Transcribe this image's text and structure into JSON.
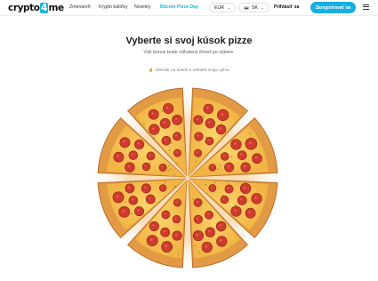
{
  "header": {
    "logo_prefix": "crypto",
    "logo_four": "4",
    "logo_suffix": "me",
    "nav": [
      "Zmenáreň",
      "Krypto balíčky",
      "Novinky",
      "Bitcoin Pizza Day"
    ],
    "currency": "EUR",
    "language": "SK",
    "login": "Prihlásiť sa",
    "cta": "Zaregistrovať sa"
  },
  "main": {
    "title": "Vyberte si svoj kúsok pizze",
    "subtitle": "Váš bonus bude odhalený ihneď po výbere.",
    "hint": "Kliknite na kúsok a odhaľte svoju výhru",
    "slices": 8
  },
  "colors": {
    "accent": "#18aee0",
    "crust": "#e39a45",
    "cheese": "#f8c653",
    "pepperoni": "#cf3b2c"
  }
}
